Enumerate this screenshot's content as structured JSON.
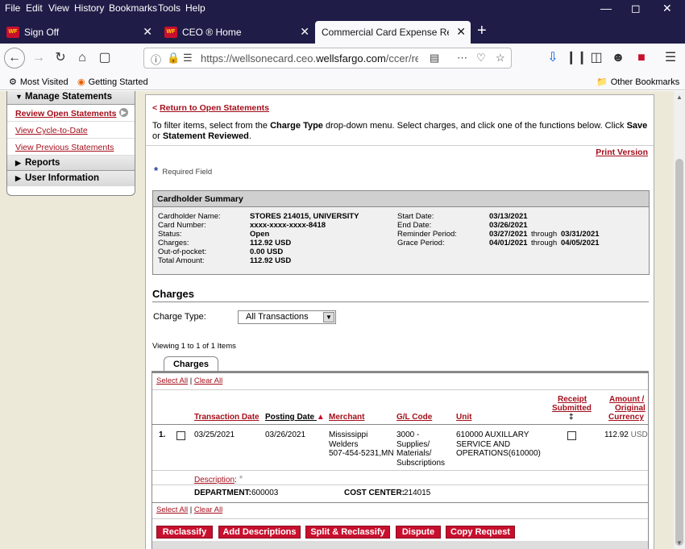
{
  "menubar": [
    "File",
    "Edit",
    "View",
    "History",
    "Bookmarks",
    "Tools",
    "Help"
  ],
  "tabs": [
    {
      "label": "Sign Off",
      "icon": "WF"
    },
    {
      "label": "CEO ® Home",
      "icon": "WF"
    },
    {
      "label": "Commercial Card Expense Reporting"
    }
  ],
  "address": {
    "prefix": "https://wellsonecard.ceo.",
    "host": "wellsfargo.com",
    "path": "/ccer/recView"
  },
  "bookmarks": {
    "most_visited": "Most Visited",
    "getting_started": "Getting Started",
    "other": "Other Bookmarks"
  },
  "sidebar": {
    "manage": "Manage Statements",
    "items": [
      "Review Open Statements",
      "View Cycle-to-Date",
      "View Previous Statements"
    ],
    "reports": "Reports",
    "user_info": "User Information"
  },
  "page": {
    "return_link": "Return to Open Statements",
    "return_arrow": "<",
    "instruction_1": "To filter items, select from the ",
    "instruction_b1": "Charge Type",
    "instruction_2": " drop-down menu. Select charges, and click one of the functions below. Click ",
    "instruction_b2": "Save",
    "instruction_3": " or",
    "instruction_b3": "Statement Reviewed",
    "instruction_4": ".",
    "print_version": "Print Version",
    "required_field": "Required Field"
  },
  "summary": {
    "title": "Cardholder Summary",
    "left": [
      {
        "label": "Cardholder Name:",
        "value": "STORES 214015, UNIVERSITY"
      },
      {
        "label": "Card Number:",
        "value": "xxxx-xxxx-xxxx-8418"
      },
      {
        "label": "Status:",
        "value": "Open"
      },
      {
        "label": "Charges:",
        "value": "112.92 USD"
      },
      {
        "label": "Out-of-pocket:",
        "value": "0.00 USD"
      },
      {
        "label": "Total Amount:",
        "value": "112.92 USD"
      }
    ],
    "right": [
      {
        "label": "Start Date:",
        "value": "03/13/2021"
      },
      {
        "label": "End Date:",
        "value": "03/26/2021"
      },
      {
        "label": "Reminder Period:",
        "value": "03/27/2021",
        "through": "through",
        "value2": "03/31/2021"
      },
      {
        "label": "Grace Period:",
        "value": "04/01/2021",
        "through": "through",
        "value2": "04/05/2021"
      }
    ]
  },
  "charges": {
    "heading": "Charges",
    "type_label": "Charge Type:",
    "type_value": "All Transactions",
    "viewing": "Viewing 1 to 1 of 1 Items",
    "tab": "Charges",
    "select_all": "Select All",
    "clear_all": "Clear All",
    "separator": "|",
    "columns": {
      "txn_date": "Transaction Date",
      "post_date": "Posting Date",
      "merchant": "Merchant",
      "gl_code": "G/L Code",
      "unit": "Unit",
      "receipt_1": "Receipt",
      "receipt_2": "Submitted",
      "receipt_3": "‡",
      "amount_1": "Amount /",
      "amount_2": "Original",
      "amount_3": "Currency"
    },
    "row": {
      "num": "1.",
      "txn_date": "03/25/2021",
      "post_date": "03/26/2021",
      "merchant": [
        "Mississippi",
        "Welders",
        "507-454-5231,MN"
      ],
      "gl_code": [
        "3000 -",
        "Supplies/",
        "Materials/",
        "Subscriptions"
      ],
      "unit": [
        "610000 AUXILLARY",
        "SERVICE AND",
        "OPERATIONS(610000)"
      ],
      "amount": "112.92",
      "currency": "USD",
      "description_label": "Description",
      "department_label": "DEPARTMENT:",
      "department": "600003",
      "cost_center_label": "COST CENTER:",
      "cost_center": "214015"
    },
    "buttons": [
      "Reclassify",
      "Add Descriptions",
      "Split & Reclassify",
      "Dispute",
      "Copy Request"
    ]
  },
  "colors": {
    "brand_red": "#a40e1b",
    "button_red": "#c8102e",
    "chrome": "#1f1c47"
  }
}
